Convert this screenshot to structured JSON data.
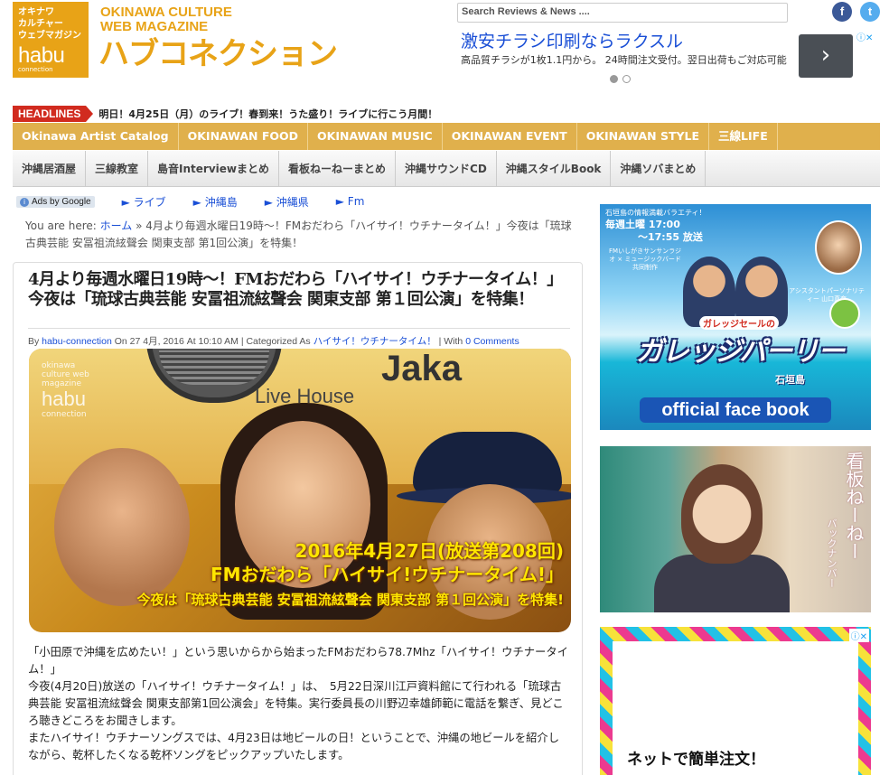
{
  "header": {
    "logo_jp": [
      "オキナワ",
      "カルチャー",
      "ウェブマガジン"
    ],
    "logo_habu": "habu",
    "logo_small": "connection",
    "site_en_1": "OKINAWA CULTURE",
    "site_en_2": "WEB MAGAZINE",
    "site_jp": "ハブコネクション",
    "search_placeholder": "Search Reviews & News ....",
    "social": {
      "facebook": "f",
      "twitter": "t"
    }
  },
  "ad_top": {
    "title": "激安チラシ印刷ならラクスル",
    "sub": "高品質チラシが1枚1.1円から。 24時間注文受付。翌日出荷もご対応可能",
    "next": "›",
    "choice": "ⓘ✕"
  },
  "headlines": {
    "tag": "HEADLINES",
    "text": "明日！4月25日（月）のライブ！春到来！うた盛り！ライブに行こう月間！"
  },
  "nav_primary": [
    "Okinawa Artist Catalog",
    "OKINAWAN FOOD",
    "OKINAWAN MUSIC",
    "OKINAWAN EVENT",
    "OKINAWAN STYLE",
    "三線LIFE"
  ],
  "nav_secondary": [
    "沖縄居酒屋",
    "三線教室",
    "島音Interviewまとめ",
    "看板ねーねーまとめ",
    "沖縄サウンドCD",
    "沖縄スタイルBook",
    "沖縄ソバまとめ"
  ],
  "ads_row": {
    "label": "Ads by Google",
    "links": [
      "► ライブ",
      "► 沖縄島",
      "► 沖縄県",
      "► Fm"
    ]
  },
  "breadcrumb": {
    "prefix": "You are here: ",
    "home": "ホーム",
    "rest": " » 4月より毎週水曜日19時〜！FMおだわら「ハイサイ！ウチナータイム！」今夜は「琉球古典芸能 安冨祖流絃聲会 関東支部 第1回公演」を特集！"
  },
  "article": {
    "title": "4月より毎週水曜日19時〜！FMおだわら「ハイサイ！ウチナータイム！」今夜は「琉球古典芸能 安冨祖流絃聲会 関東支部 第１回公演」を特集！",
    "meta_by": "By ",
    "meta_author": "habu-connection",
    "meta_on": " On 27 4月, 2016 At 10:10 AM | Categorized As ",
    "meta_category": "ハイサイ！ウチナータイム！",
    "meta_with": " | With ",
    "meta_comments": "0 Comments",
    "photo": {
      "live_house": "Live House",
      "brand": "Jaka",
      "wm_top": "okinawa culture web magazine",
      "wm_big": "habu",
      "wm_bottom": "connection",
      "caption_1": "2016年4月27日(放送第208回)",
      "caption_2": "FMおだわら「ハイサイ!ウチナータイム!」",
      "caption_3": "今夜は「琉球古典芸能 安冨祖流絃聲会 関東支部 第１回公演」を特集!"
    },
    "paragraphs": [
      "「小田原で沖縄を広めたい！」という思いからから始まったFMおだわら78.7Mhz「ハイサイ！ウチナータイム！」",
      "今夜(4月20日)放送の「ハイサイ！ウチナータイム！」は、　5月22日深川江戸資料館にて行われる「琉球古典芸能 安冨祖流絃聲会 関東支部第1回公演会」を特集。実行委員長の川野辺幸雄師範に電話を繋ぎ、見どころ聴きどころをお聞きします。",
      "またハイサイ！ウチナーソングスでは、4月23日は地ビールの日！ということで、沖縄の地ビールを紹介しながら、乾杯したくなる乾杯ソングをピックアップいたします。"
    ]
  },
  "sidebar": {
    "banner1": {
      "header": "石垣島の情報満載バラエティ！",
      "time_1": "毎週土曜 17:00",
      "time_2": "〜17:55 放送",
      "small": "FMいしがきサンサンラジオ × ミュージックバード 共同制作",
      "assist": "アシスタントパーソナリティー 山口真奈",
      "tag": "ガレッジセールの",
      "big": "ガレッジパーリー",
      "loc": "石垣島",
      "fb": "official face book"
    },
    "banner2": {
      "v1": "看板ねーねー",
      "v2": "バックナンバー"
    },
    "banner3": {
      "text": "ネットで簡単注文！",
      "choice": "ⓘ✕"
    }
  }
}
